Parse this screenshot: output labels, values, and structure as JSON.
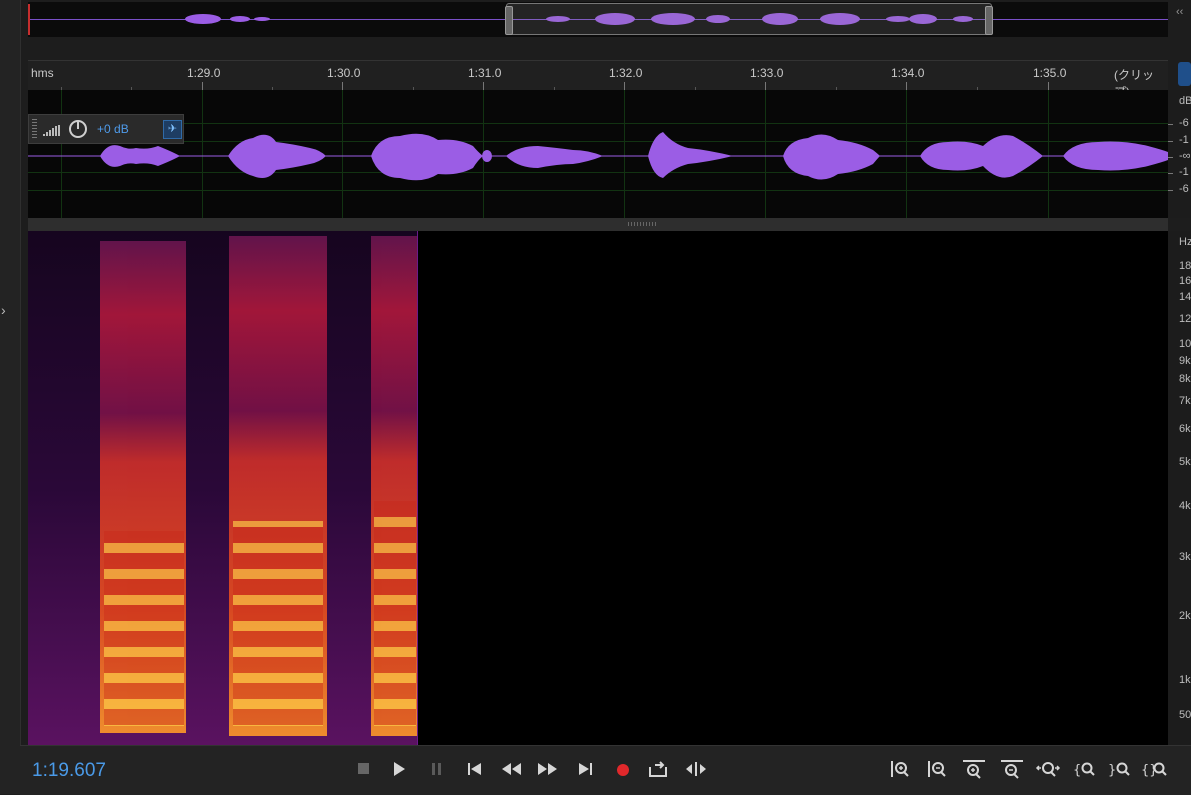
{
  "overview": {
    "label": ""
  },
  "top_right_control": "‹‹",
  "ruler": {
    "units_label": "hms",
    "ticks": [
      "1:29.0",
      "1:30.0",
      "1:31.0",
      "1:32.0",
      "1:33.0",
      "1:34.0",
      "1:35.0"
    ],
    "clip_label": "(クリップ)"
  },
  "waveform": {
    "color": "#9b5de5",
    "volume_value": "+0 dB",
    "scale_unit": "dB",
    "scale_labels": [
      "-6",
      "-1",
      "-∞",
      "-1",
      "-6"
    ]
  },
  "spectrogram": {
    "hz_labels": [
      "Hz",
      "18",
      "16",
      "14",
      "12",
      "10",
      "9k",
      "8k",
      "7k",
      "6k",
      "5k",
      "4k",
      "3k",
      "2k",
      "1k",
      "50"
    ]
  },
  "transport": {
    "time": "1:19.607",
    "record_color": "#e0282b"
  },
  "icons": [
    "stop-icon",
    "play-icon",
    "pause-icon",
    "go-to-start-icon",
    "rewind-icon",
    "fast-forward-icon",
    "go-to-end-icon",
    "record-icon",
    "loop-playback-icon",
    "skip-selection-icon",
    "zoom-in-amplitude-icon",
    "zoom-out-amplitude-icon",
    "zoom-in-time-icon",
    "zoom-out-time-icon",
    "zoom-full-icon",
    "zoom-in-selection-icon",
    "zoom-out-selection-icon",
    "zoom-selection-icon"
  ]
}
